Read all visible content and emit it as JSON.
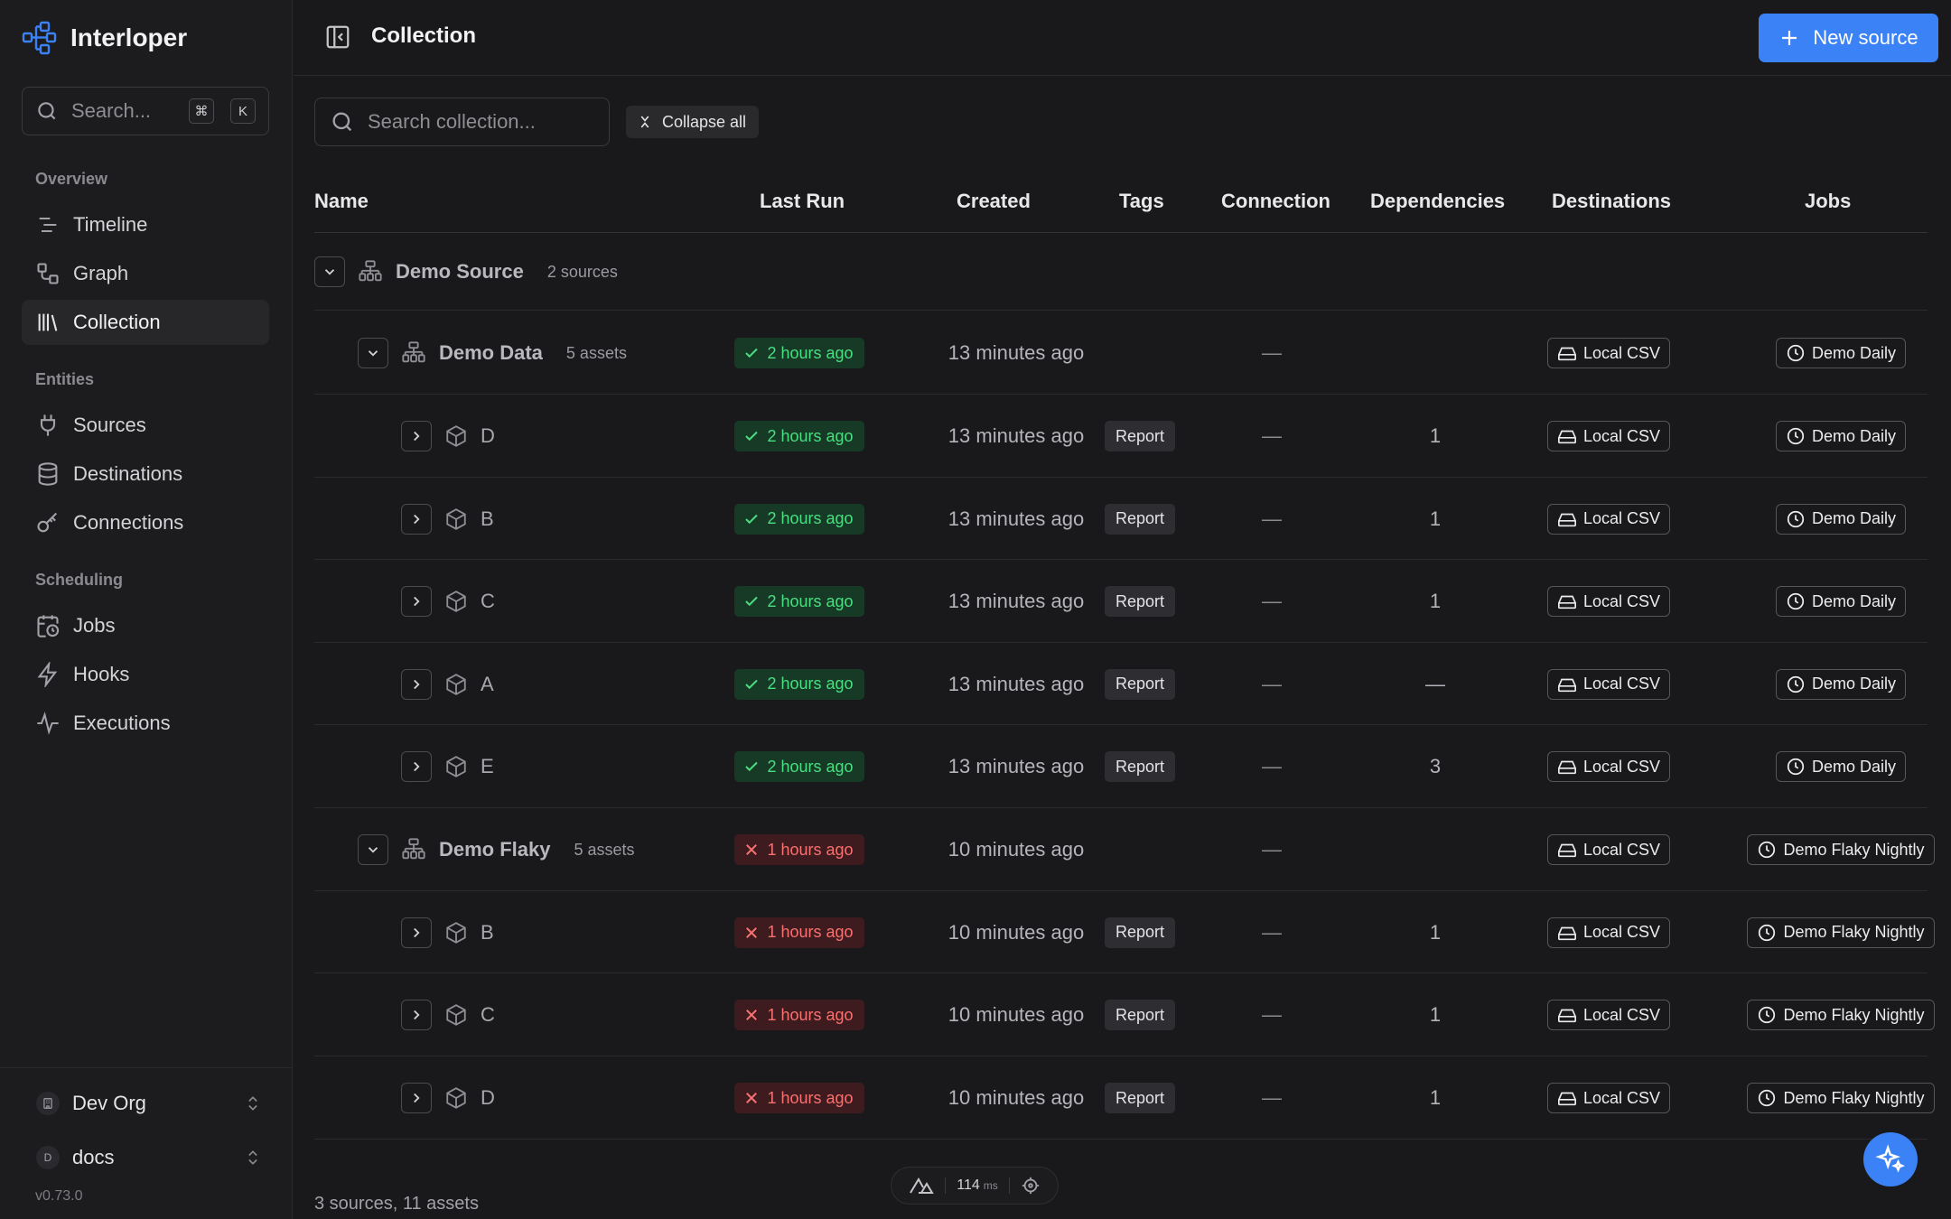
{
  "app": {
    "name": "Interloper",
    "version": "v0.73.0"
  },
  "sidebar": {
    "search_placeholder": "Search...",
    "shortcut_keys": [
      "⌘",
      "K"
    ],
    "sections": [
      {
        "label": "Overview"
      },
      {
        "label": "Entities"
      },
      {
        "label": "Scheduling"
      }
    ],
    "items": [
      {
        "label": "Timeline",
        "icon": "timeline-icon"
      },
      {
        "label": "Graph",
        "icon": "graph-icon"
      },
      {
        "label": "Collection",
        "icon": "library-icon",
        "active": true
      },
      {
        "label": "Sources",
        "icon": "plug-icon"
      },
      {
        "label": "Destinations",
        "icon": "database-icon"
      },
      {
        "label": "Connections",
        "icon": "key-icon"
      },
      {
        "label": "Jobs",
        "icon": "calendar-clock-icon"
      },
      {
        "label": "Hooks",
        "icon": "zap-icon"
      },
      {
        "label": "Executions",
        "icon": "activity-icon"
      }
    ],
    "org": {
      "name": "Dev Org"
    },
    "workspace": {
      "badge": "D",
      "name": "docs"
    }
  },
  "header": {
    "title": "Collection",
    "new_button": "New source"
  },
  "toolbar": {
    "search_placeholder": "Search collection...",
    "collapse_label": "Collapse all"
  },
  "table": {
    "columns": [
      "Name",
      "Last Run",
      "Created",
      "Tags",
      "Connection",
      "Dependencies",
      "Destinations",
      "Jobs"
    ],
    "rows": [
      {
        "kind": "source",
        "name": "Demo Source",
        "count": "2 sources"
      },
      {
        "kind": "group",
        "name": "Demo Data",
        "count": "5 assets",
        "status": "ok",
        "last_run": "2 hours ago",
        "created": "13 minutes ago",
        "tag": "",
        "connection": "—",
        "deps": "",
        "destination": "Local CSV",
        "job": "Demo Daily"
      },
      {
        "kind": "asset",
        "name": "D",
        "status": "ok",
        "last_run": "2 hours ago",
        "created": "13 minutes ago",
        "tag": "Report",
        "connection": "—",
        "deps": "1",
        "destination": "Local CSV",
        "job": "Demo Daily"
      },
      {
        "kind": "asset",
        "name": "B",
        "status": "ok",
        "last_run": "2 hours ago",
        "created": "13 minutes ago",
        "tag": "Report",
        "connection": "—",
        "deps": "1",
        "destination": "Local CSV",
        "job": "Demo Daily"
      },
      {
        "kind": "asset",
        "name": "C",
        "status": "ok",
        "last_run": "2 hours ago",
        "created": "13 minutes ago",
        "tag": "Report",
        "connection": "—",
        "deps": "1",
        "destination": "Local CSV",
        "job": "Demo Daily"
      },
      {
        "kind": "asset",
        "name": "A",
        "status": "ok",
        "last_run": "2 hours ago",
        "created": "13 minutes ago",
        "tag": "Report",
        "connection": "—",
        "deps": "—",
        "destination": "Local CSV",
        "job": "Demo Daily"
      },
      {
        "kind": "asset",
        "name": "E",
        "status": "ok",
        "last_run": "2 hours ago",
        "created": "13 minutes ago",
        "tag": "Report",
        "connection": "—",
        "deps": "3",
        "destination": "Local CSV",
        "job": "Demo Daily"
      },
      {
        "kind": "group",
        "name": "Demo Flaky",
        "count": "5 assets",
        "status": "fail",
        "last_run": "1 hours ago",
        "created": "10 minutes ago",
        "tag": "",
        "connection": "—",
        "deps": "",
        "destination": "Local CSV",
        "job": "Demo Flaky Nightly"
      },
      {
        "kind": "asset",
        "name": "B",
        "status": "fail",
        "last_run": "1 hours ago",
        "created": "10 minutes ago",
        "tag": "Report",
        "connection": "—",
        "deps": "1",
        "destination": "Local CSV",
        "job": "Demo Flaky Nightly"
      },
      {
        "kind": "asset",
        "name": "C",
        "status": "fail",
        "last_run": "1 hours ago",
        "created": "10 minutes ago",
        "tag": "Report",
        "connection": "—",
        "deps": "1",
        "destination": "Local CSV",
        "job": "Demo Flaky Nightly"
      },
      {
        "kind": "asset",
        "name": "D",
        "status": "fail",
        "last_run": "1 hours ago",
        "created": "10 minutes ago",
        "tag": "Report",
        "connection": "—",
        "deps": "1",
        "destination": "Local CSV",
        "job": "Demo Flaky Nightly"
      }
    ]
  },
  "footer": {
    "summary": "3 sources, 11 assets",
    "latency_value": "114",
    "latency_unit": "ms"
  },
  "colors": {
    "accent": "#3b82f6",
    "success": "#4ade80",
    "failure": "#f87171"
  }
}
